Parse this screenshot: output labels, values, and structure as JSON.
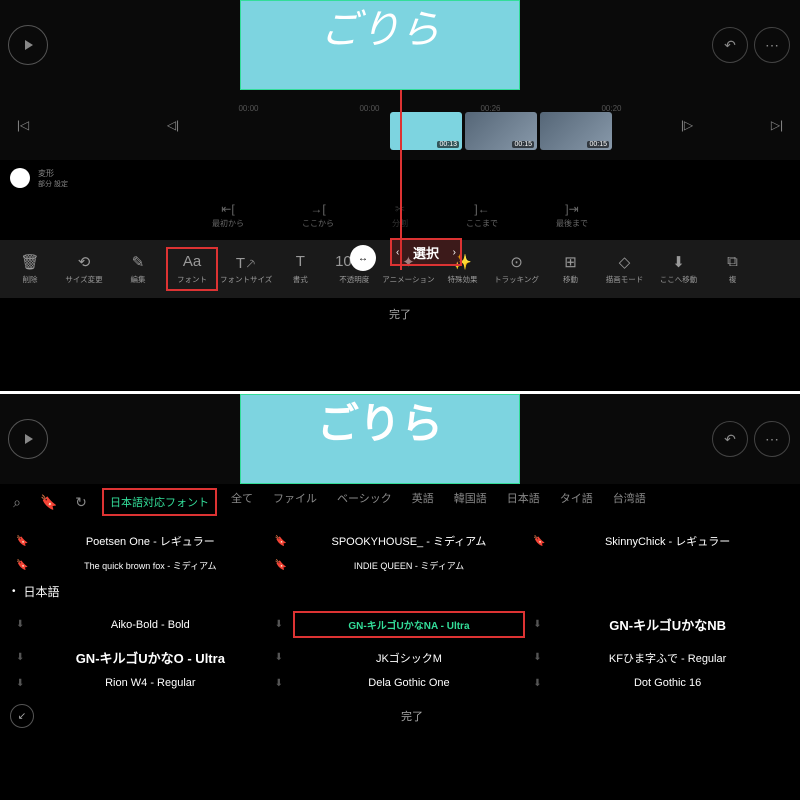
{
  "top": {
    "preview_text": "ごりら",
    "timecodes": [
      "00:00",
      "00:00",
      "00:26",
      "00:20"
    ],
    "clips": [
      {
        "time": "00:13"
      },
      {
        "time": "00:15"
      },
      {
        "time": "00:15"
      }
    ],
    "select_label": "選択",
    "transform": {
      "title": "変形",
      "sub": "部分\n設定"
    },
    "cuts": [
      {
        "icon": "⇤[",
        "label": "最初から"
      },
      {
        "icon": "→[",
        "label": "ここから"
      },
      {
        "icon": "✂",
        "label": "分割",
        "dim": true
      },
      {
        "icon": "]←",
        "label": "ここまで"
      },
      {
        "icon": "]⇥",
        "label": "最後まで"
      }
    ],
    "tools": [
      {
        "icon": "🗑",
        "label": "削除"
      },
      {
        "icon": "⟲",
        "label": "サイズ変更"
      },
      {
        "icon": "✎",
        "label": "編集"
      },
      {
        "icon": "Aa",
        "label": "フォント",
        "hl": true
      },
      {
        "icon": "T⸕",
        "label": "フォントサイズ"
      },
      {
        "icon": "T",
        "label": "書式"
      },
      {
        "icon": "100%",
        "label": "不透明度"
      },
      {
        "icon": "✦",
        "label": "アニメーション"
      },
      {
        "icon": "✨",
        "label": "特殊効果"
      },
      {
        "icon": "⊙",
        "label": "トラッキング"
      },
      {
        "icon": "⊞",
        "label": "移動"
      },
      {
        "icon": "◇",
        "label": "描画モード"
      },
      {
        "icon": "⬇",
        "label": "ここへ移動"
      },
      {
        "icon": "⧉",
        "label": "複"
      }
    ],
    "done": "完了"
  },
  "bot": {
    "preview_text": "ごりら",
    "tabs": [
      "日本語対応フォント",
      "全て",
      "ファイル",
      "ベーシック",
      "英語",
      "韓国語",
      "日本語",
      "タイ語",
      "台湾語"
    ],
    "row1": [
      {
        "name": "Poetsen One - レギュラー"
      },
      {
        "name": "SPOOKYHOUSE_ - ミディアム"
      },
      {
        "name": "SkinnyChick - レギュラー"
      }
    ],
    "row2": [
      {
        "name": "The quick brown fox - ミディアム"
      },
      {
        "name": "INDIE QUEEN - ミディアム"
      }
    ],
    "section": "日本語",
    "grid": [
      {
        "name": "Aiko-Bold - Bold"
      },
      {
        "name": "GN-キルゴUかなNA - Ultra",
        "hl": true
      },
      {
        "name": "GN-キルゴUかなNB",
        "bold": true
      },
      {
        "name": "GN-キルゴUかなO - Ultra",
        "bold": true
      },
      {
        "name": "JKゴシックM"
      },
      {
        "name": "KFひま字ふで - Regular"
      },
      {
        "name": "Rion W4 - Regular"
      },
      {
        "name": "Dela Gothic One"
      },
      {
        "name": "Dot Gothic 16"
      }
    ],
    "done": "完了"
  }
}
